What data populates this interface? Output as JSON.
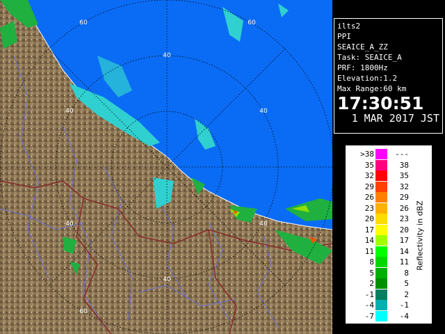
{
  "info": {
    "site": "ilts2",
    "scan_type": "PPI",
    "product": "SEAICE_A_ZZ",
    "task": "Task: SEAICE_A",
    "prf": "PRF: 1800Hz",
    "elevation": "Elevation:1.2",
    "max_range": "Max Range:60 km",
    "time": "17:30:51",
    "date": "1 MAR 2017 JST"
  },
  "range_labels": {
    "r60a": "60",
    "r60b": "60",
    "r60c": "60",
    "r40a": "40",
    "r40b": "40",
    "r40c": "40",
    "r40d": "40",
    "r40e": "40"
  },
  "legend": {
    "title": "Reflectivity in dBZ",
    "rows": [
      {
        "lo": ">38",
        "hi": "---",
        "color": "#ff00ff"
      },
      {
        "lo": "35",
        "hi": "38",
        "color": "#ff0080"
      },
      {
        "lo": "32",
        "hi": "35",
        "color": "#ff0000"
      },
      {
        "lo": "29",
        "hi": "32",
        "color": "#ff4000"
      },
      {
        "lo": "26",
        "hi": "29",
        "color": "#ff8000"
      },
      {
        "lo": "23",
        "hi": "26",
        "color": "#ffb000"
      },
      {
        "lo": "20",
        "hi": "23",
        "color": "#ffdc00"
      },
      {
        "lo": "17",
        "hi": "20",
        "color": "#ffff00"
      },
      {
        "lo": "14",
        "hi": "17",
        "color": "#a0ff00"
      },
      {
        "lo": "11",
        "hi": "14",
        "color": "#00ff00"
      },
      {
        "lo": "8",
        "hi": "11",
        "color": "#00d800"
      },
      {
        "lo": "5",
        "hi": "8",
        "color": "#00b000"
      },
      {
        "lo": "2",
        "hi": "5",
        "color": "#009000"
      },
      {
        "lo": "-1",
        "hi": "2",
        "color": "#008060"
      },
      {
        "lo": "-4",
        "hi": "-1",
        "color": "#00b0b0"
      },
      {
        "lo": "-7",
        "hi": "-4",
        "color": "#00ffff"
      }
    ]
  },
  "colors": {
    "sea": "#0a6cf4",
    "land": "#8a7050",
    "river": "#6a70d0",
    "border": "#8a2a2a"
  }
}
